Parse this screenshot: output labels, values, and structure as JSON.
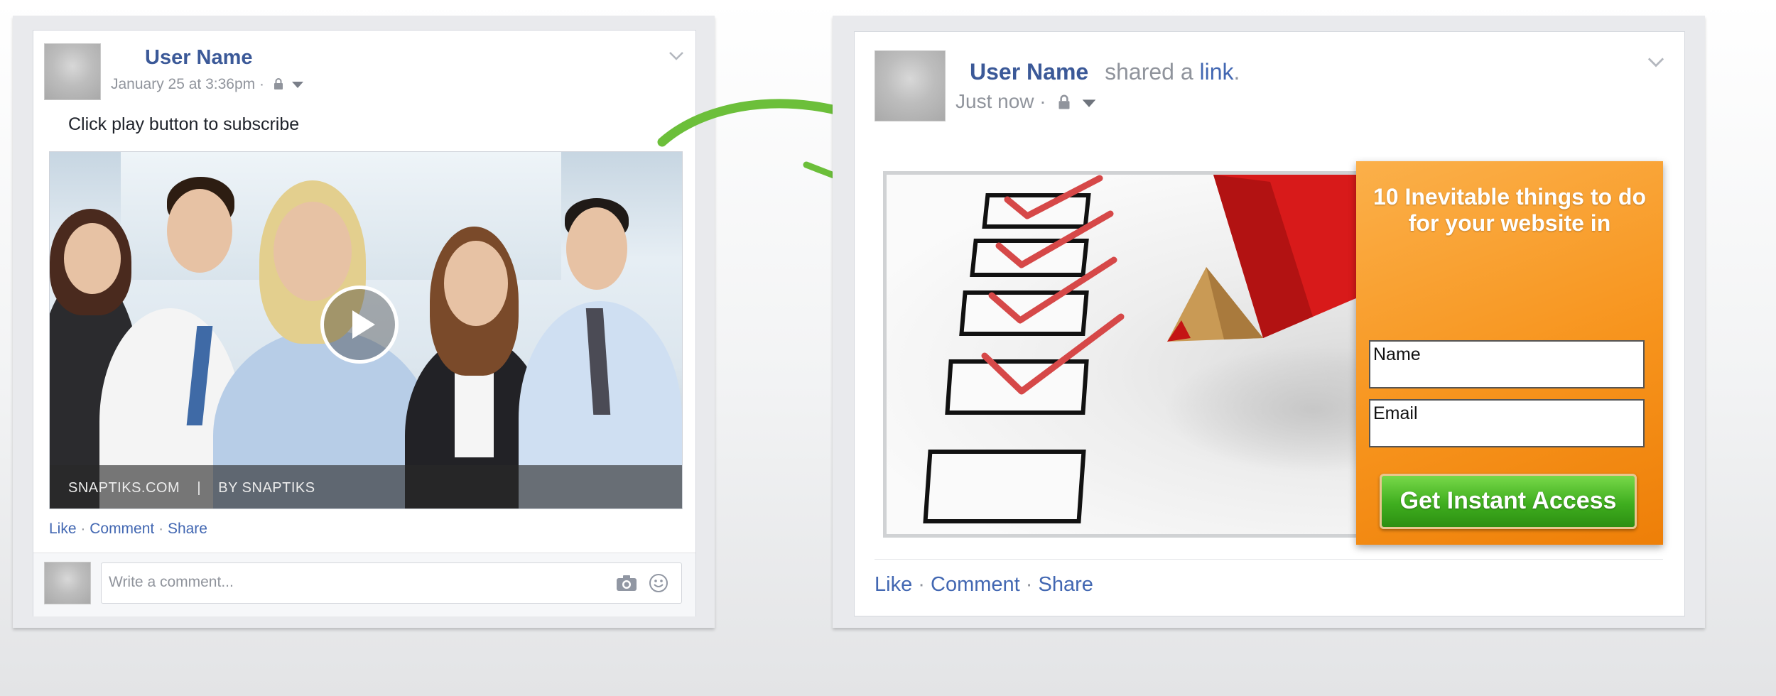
{
  "left_post": {
    "user_name": "User Name",
    "timestamp": "January 25 at 3:36pm ·",
    "post_text": "Click play button to subscribe",
    "video_caption": "SNAPTIKS.COM    |    BY SNAPTIKS",
    "actions": {
      "like": "Like",
      "comment": "Comment",
      "share": "Share",
      "sep": "·"
    },
    "comment_placeholder": "Write a comment..."
  },
  "right_post": {
    "user_name": "User Name",
    "shared_text": "shared a",
    "link_text": "link",
    "period": ".",
    "timestamp": "Just now ·",
    "optin": {
      "headline": "10 Inevitable things to do for your website in",
      "name_label": "Name",
      "email_label": "Email",
      "cta": "Get Instant Access"
    },
    "actions": {
      "like": "Like",
      "comment": "Comment",
      "share": "Share",
      "sep": "·"
    }
  },
  "colors": {
    "facebook_blue": "#3b5998",
    "link_blue": "#4267b2",
    "arrow_green": "#6cbf3a",
    "optin_orange": "#f7941d",
    "cta_green": "#3fae1f",
    "check_red": "#d64848"
  }
}
